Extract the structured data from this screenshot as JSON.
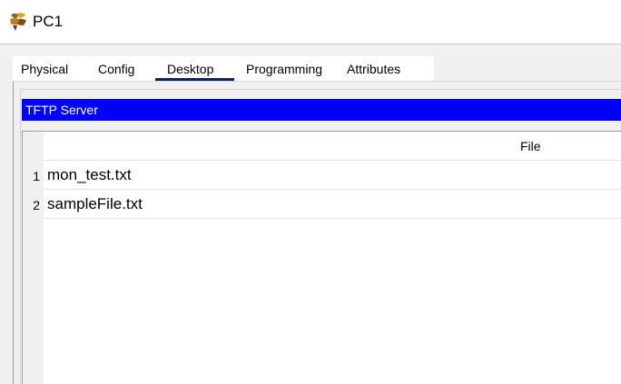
{
  "window": {
    "title": "PC1",
    "icon": "pc-app-icon"
  },
  "tabs": [
    {
      "label": "Physical",
      "active": false
    },
    {
      "label": "Config",
      "active": false
    },
    {
      "label": "Desktop",
      "active": true
    },
    {
      "label": "Programming",
      "active": false
    },
    {
      "label": "Attributes",
      "active": false
    }
  ],
  "app": {
    "title": "TFTP Server",
    "header_color": "#0000ff"
  },
  "file_table": {
    "column_header": "File",
    "rows": [
      {
        "num": "1",
        "file": "mon_test.txt"
      },
      {
        "num": "2",
        "file": "sampleFile.txt"
      }
    ]
  },
  "colors": {
    "active_tab_underline": "#0a246a",
    "header_text": "#ffffff"
  }
}
